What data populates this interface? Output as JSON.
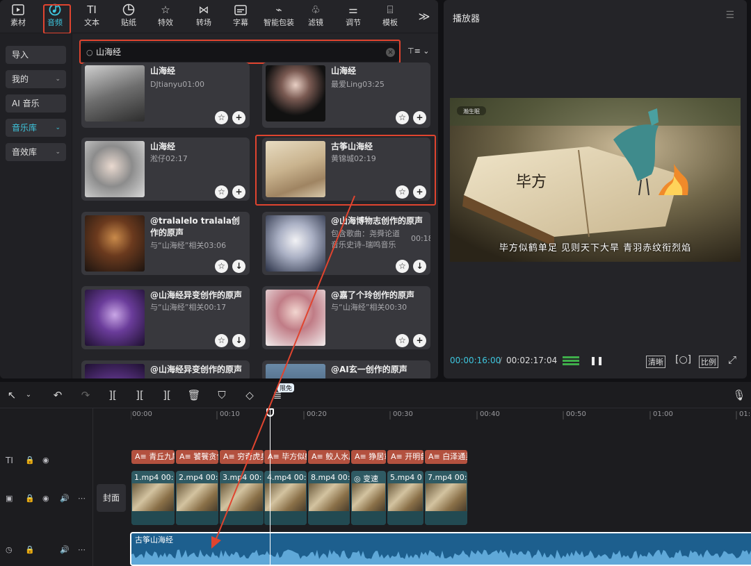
{
  "toolbar": {
    "tabs": [
      {
        "label": "素材",
        "icon": "media-icon"
      },
      {
        "label": "音频",
        "icon": "audio-icon",
        "active": true
      },
      {
        "label": "文本",
        "icon": "text-icon"
      },
      {
        "label": "贴纸",
        "icon": "sticker-icon"
      },
      {
        "label": "特效",
        "icon": "effects-icon"
      },
      {
        "label": "转场",
        "icon": "transition-icon"
      },
      {
        "label": "字幕",
        "icon": "caption-icon"
      },
      {
        "label": "智能包装",
        "icon": "smart-pack-icon"
      },
      {
        "label": "滤镜",
        "icon": "filter-icon"
      },
      {
        "label": "调节",
        "icon": "adjust-icon"
      },
      {
        "label": "模板",
        "icon": "template-icon"
      }
    ],
    "more": "≫"
  },
  "sidebar": {
    "items": [
      {
        "label": "导入"
      },
      {
        "label": "我的",
        "chevron": "⌄"
      },
      {
        "label": "AI 音乐"
      },
      {
        "label": "音乐库",
        "chevron": "⌄",
        "active": true
      },
      {
        "label": "音效库",
        "chevron": "⌄"
      }
    ]
  },
  "search": {
    "value": "山海经",
    "clear": "×",
    "filter": "⊤≡ ⌄"
  },
  "cards": [
    {
      "title": "山海经",
      "meta": "DJtianyu01:00",
      "btn": "+"
    },
    {
      "title": "山海经",
      "meta": "最爱Ling03:25",
      "btn": "+"
    },
    {
      "title": "山海经",
      "meta": "淞仔02:17",
      "btn": "+"
    },
    {
      "title": "古筝山海经",
      "meta": "黄锦城02:19",
      "btn": "+"
    },
    {
      "title": "@tralalelo tralala创作的原声",
      "meta": "与“山海经”相关03:06",
      "btn": "↓"
    },
    {
      "title": "@山海博物志创作的原声",
      "meta": "包含歌曲：尧舜论道 音乐史诗–瑞鸣音乐",
      "dur": "00:18",
      "btn": "↓"
    },
    {
      "title": "@山海经异变创作的原声",
      "meta": "与“山海经”相关00:17",
      "btn": "↓"
    },
    {
      "title": "@嘉了个玲创作的原声",
      "meta": "与“山海经”相关00:30",
      "btn": "+"
    },
    {
      "title": "@山海经异变创作的原声",
      "meta": "",
      "btn": ""
    },
    {
      "title": "@AI玄一创作的原声",
      "meta": "",
      "btn": ""
    }
  ],
  "player": {
    "title": "播放器",
    "menu": "☰",
    "video_badge": "瀚生眠",
    "book_text": "毕方",
    "subtitle": "毕方似鹤单足 见则天下大旱 青羽赤纹衔烈焰",
    "current_time": "00:00:16:00",
    "separator": "/",
    "total_time": "00:02:17:04",
    "play_icon": "❚❚",
    "quality": "清晰",
    "ratio": "比例",
    "fullscreen": "⤢"
  },
  "timeline": {
    "free_badge": "限免",
    "ruler": [
      "00:00",
      "00:10",
      "00:20",
      "00:30",
      "00:40",
      "00:50",
      "01:00",
      "01:"
    ],
    "text_clips": [
      "青丘九尾",
      "饕餮贪食",
      "穷奇虎身",
      "毕方似鹤",
      "鲛人水居",
      "狰居章莪",
      "开明兽",
      "白泽通灵"
    ],
    "video_clips": [
      {
        "name": "1.mp4",
        "dur": "00:"
      },
      {
        "name": "2.mp4",
        "dur": "00:"
      },
      {
        "name": "3.mp4",
        "dur": "00:"
      },
      {
        "name": "4.mp4",
        "dur": "00:"
      },
      {
        "name": "8.mp4",
        "dur": "00:"
      },
      {
        "name": "变速",
        "dur": ""
      },
      {
        "name": "5.mp4",
        "dur": "0"
      },
      {
        "name": "7.mp4",
        "dur": "00:"
      }
    ],
    "cover": "封面",
    "audio_clip": "古筝山海经",
    "colors": {
      "text_clip": "#b3513f",
      "video_clip": "#2f5a63",
      "audio_clip": "#1d5f8e",
      "accent": "#3ec6de",
      "highlight": "#e0442f"
    }
  }
}
